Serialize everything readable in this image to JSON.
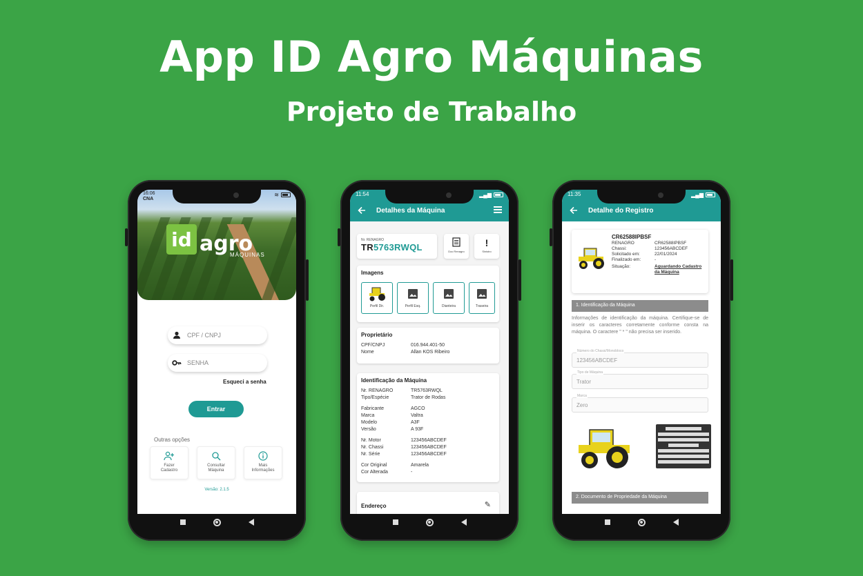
{
  "headline": {
    "title": "App ID Agro Máquinas",
    "subtitle": "Projeto de Trabalho"
  },
  "colors": {
    "background": "#3ba446",
    "accent": "#1f9a94",
    "logo_green": "#7cc242"
  },
  "phone1": {
    "status_time": "16:06",
    "status_brand": "CNA",
    "logo_id": "id",
    "logo_agro": "agro",
    "logo_sub": "MÁQUINAS",
    "cpf_placeholder": "CPF / CNPJ",
    "password_placeholder": "SENHA",
    "forgot_password": "Esqueci a senha",
    "login_button": "Entrar",
    "other_options_title": "Outras opções",
    "options": [
      {
        "line1": "Fazer",
        "line2": "Cadastro",
        "icon": "add-user-icon"
      },
      {
        "line1": "Consultar",
        "line2": "Máquina",
        "icon": "search-icon"
      },
      {
        "line1": "Mais",
        "line2": "Informações",
        "icon": "info-icon"
      }
    ],
    "version": "Versão: 2.1.5"
  },
  "phone2": {
    "status_time": "11:54",
    "appbar_title": "Detalhes da Máquina",
    "renagro_label": "Nr. RENAGRO",
    "renagro_prefix": "TR",
    "renagro_code": "5763RWQL",
    "btn_documento": "Doc Renagro",
    "btn_sinistro": "Sinistro",
    "images_title": "Imagens",
    "image_tiles": [
      "Perfil Dir.",
      "Perfil Esq.",
      "Dianteira",
      "Traseira"
    ],
    "owner_title": "Proprietário",
    "owner": [
      {
        "k": "CPF/CNPJ",
        "v": "016.944.401-50"
      },
      {
        "k": "Nome",
        "v": "Allan KOS Ribeiro"
      }
    ],
    "ident_title": "Identificação da Máquina",
    "ident_group1": [
      {
        "k": "Nr. RENAGRO",
        "v": "TR5763RWQL"
      },
      {
        "k": "Tipo/Espécie",
        "v": "Trator de Rodas"
      }
    ],
    "ident_group2": [
      {
        "k": "Fabricante",
        "v": "AGCO"
      },
      {
        "k": "Marca",
        "v": "Valtra"
      },
      {
        "k": "Modelo",
        "v": "A3F"
      },
      {
        "k": "Versão",
        "v": "A 93F"
      }
    ],
    "ident_group3": [
      {
        "k": "Nr. Motor",
        "v": "123456ABCDEF"
      },
      {
        "k": "Nr. Chassi",
        "v": "123456ABCDEF"
      },
      {
        "k": "Nr. Série",
        "v": "123456ABCDEF"
      }
    ],
    "ident_group4": [
      {
        "k": "Cor Original",
        "v": "Amarela"
      },
      {
        "k": "Cor Alterada",
        "v": "-"
      }
    ],
    "address_title": "Endereço"
  },
  "phone3": {
    "status_time": "11:35",
    "appbar_title": "Detalhe do Registro",
    "reg_code": "CR62588IPBSF",
    "reg_rows": [
      {
        "k": "RENAGRO",
        "v": "CR62588IPBSF"
      },
      {
        "k": "Chassi:",
        "v": "123456ABCDEF"
      },
      {
        "k": "Solicitado em:",
        "v": "22/01/2024"
      },
      {
        "k": "Finalizado em:",
        "v": "-"
      }
    ],
    "situacao_label": "Situação:",
    "situacao_value": "Aguardando Cadastro da Máquina",
    "section1": "1. Identificação da Máquina",
    "section1_desc": "Informações de identificação da máquina. Certifique-se de inserir os caracteres corretamente conforme consta na máquina. O caractere \" * \" não precisa ser inserido.",
    "fields": [
      {
        "label": "Número do Chassi/Monobloco",
        "value": "123456ABCDEF"
      },
      {
        "label": "Tipo de Máquina",
        "value": "Trator"
      },
      {
        "label": "Marca",
        "value": "Zero"
      }
    ],
    "section2": "2. Documento de Propriedade da Máquina"
  }
}
